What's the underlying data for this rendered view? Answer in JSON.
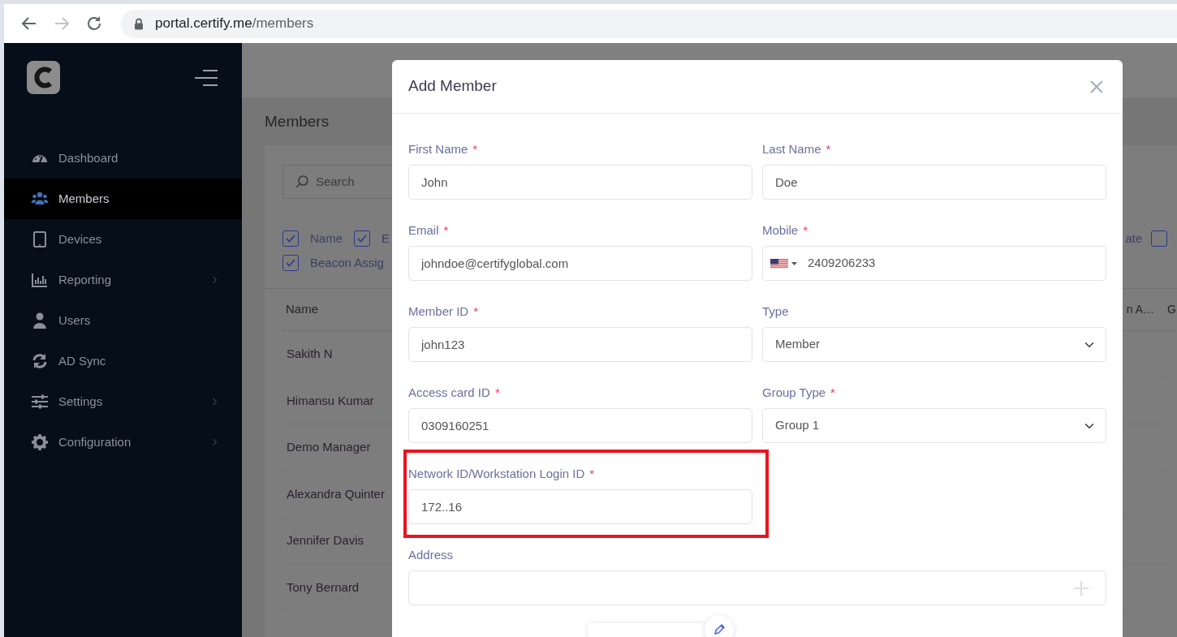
{
  "browser": {
    "url_host": "portal.certify.me",
    "url_path": "/members"
  },
  "sidebar": {
    "items": [
      {
        "label": "Dashboard",
        "selected": false,
        "submenu": false
      },
      {
        "label": "Members",
        "selected": true,
        "submenu": false
      },
      {
        "label": "Devices",
        "selected": false,
        "submenu": false
      },
      {
        "label": "Reporting",
        "selected": false,
        "submenu": true
      },
      {
        "label": "Users",
        "selected": false,
        "submenu": false
      },
      {
        "label": "AD Sync",
        "selected": false,
        "submenu": false
      },
      {
        "label": "Settings",
        "selected": false,
        "submenu": true
      },
      {
        "label": "Configuration",
        "selected": false,
        "submenu": true
      }
    ]
  },
  "page": {
    "title": "Members",
    "search": {
      "placeholder": "Search"
    },
    "column_toggles": [
      {
        "label": "Name",
        "checked": true
      },
      {
        "label": "E",
        "checked": true
      },
      {
        "label": "Beacon Assig",
        "checked": true
      }
    ],
    "column_toggles_right": [
      {
        "label": "ate"
      },
      {
        "checked": false
      }
    ],
    "table": {
      "columns": [
        "Name",
        "n A…",
        "G"
      ],
      "rows": [
        {
          "name": "Sakith N"
        },
        {
          "name": "Himansu Kumar"
        },
        {
          "name": "Demo Manager"
        },
        {
          "name": "Alexandra Quinter"
        },
        {
          "name": "Jennifer Davis"
        },
        {
          "name": "Tony Bernard"
        }
      ]
    }
  },
  "modal": {
    "title": "Add Member",
    "fields": [
      {
        "label": "First Name",
        "required_mark": "*",
        "kind": "text",
        "value": "John",
        "highlighted": false
      },
      {
        "label": "Last Name",
        "required_mark": "*",
        "kind": "text",
        "value": "Doe",
        "highlighted": false
      },
      {
        "label": "Email",
        "required_mark": "*",
        "kind": "text",
        "value": "johndoe@certifyglobal.com",
        "highlighted": false
      },
      {
        "label": "Mobile",
        "required_mark": "*",
        "kind": "phone",
        "value": "2409206233",
        "highlighted": false
      },
      {
        "label": "Member ID",
        "required_mark": "*",
        "kind": "text",
        "value": "john123",
        "highlighted": false
      },
      {
        "label": "Type",
        "kind": "select",
        "value": "Member",
        "highlighted": false
      },
      {
        "label": "Access card ID",
        "required_mark": "*",
        "kind": "text",
        "value": "0309160251",
        "highlighted": false
      },
      {
        "label": "Group Type",
        "required_mark": "*",
        "kind": "select",
        "value": "Group 1",
        "highlighted": false
      },
      {
        "label": "Network ID/Workstation Login ID",
        "required_mark": "*",
        "kind": "text",
        "value": "172..16",
        "highlighted": true
      },
      {
        "label": "Address",
        "kind": "address",
        "highlighted": false
      }
    ]
  }
}
